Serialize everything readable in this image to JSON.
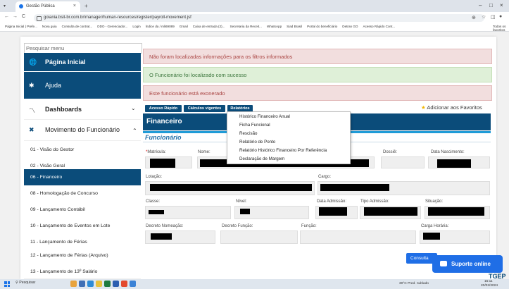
{
  "browser": {
    "tab_title": "Gestão Pública",
    "tab_close": "×",
    "new_tab": "+",
    "nav_back": "←",
    "nav_forward": "→",
    "nav_reload": "C",
    "url": "goiania.bsit-br.com.br/manager/human-resources/register/payroll-movement.jsf",
    "bookmarks": [
      "Página Inicial | Prefe...",
      "Nova guia",
      "Consulta de contrat...",
      "DDO - Gerenciador...",
      "Login",
      "Índice da / mli69089",
      "Gmail",
      "Caixa de entrada (2)...",
      "Secretaria da Receit...",
      "WhatsApp",
      "Siad Brasil",
      "Portal do beneficiário",
      "Detran GO",
      "Acesso Rápido Cont..."
    ],
    "all_favorites": "Todos os favoritos",
    "win_min": "–",
    "win_max": "□",
    "win_close": "×"
  },
  "sidebar": {
    "search_placeholder": "Pesquisar menu",
    "main_items": [
      {
        "label": "Página Inicial",
        "icon": "🌐"
      },
      {
        "label": "Ajuda",
        "icon": "✱"
      },
      {
        "label": "Dashboards",
        "icon": "〽",
        "chevron": "⌄"
      },
      {
        "label": "Movimento do Funcionário",
        "icon": "✖",
        "chevron": "⌃"
      }
    ],
    "sub_items": [
      "01 - Visão do Gestor",
      "02 - Visão Geral",
      "06 - Financeiro",
      "08 - Homologação de Concurso",
      "09 - Lançamento Contábil",
      "10 - Lançamento de Eventos em Lote",
      "11 - Lançamento de Férias",
      "12 - Lançamento de Férias (Arquivo)",
      "13 - Lançamento de 13º Salário"
    ]
  },
  "alerts": {
    "not_found": "Não foram localizadas informações para os filtros informados",
    "found": "O Funcionário foi localizado com sucesso",
    "exonerated": "Este funcionário está exonerado"
  },
  "toolbar": {
    "acesso_rapido": "Acesso Rápido",
    "calculos": "Cálculos vigentes",
    "relatorios": "Relatórios",
    "add_favorites": "Adicionar aos Favoritos",
    "star": "★"
  },
  "dropdown": [
    "Histórico Financeiro Anual",
    "Ficha Funcional",
    "Rescisão",
    "Relatório de Ponto",
    "Relatório Histórico Financeiro Por Referência",
    "Declaração de Margem"
  ],
  "form": {
    "section": "Financeiro",
    "subsection": "Funcionário",
    "required_mark": "*",
    "labels": {
      "matricula": "Matrícula:",
      "nome": "Nome:",
      "dossie": "Dossiê:",
      "nascimento": "Data Nascimento:",
      "lotacao": "Lotação:",
      "cargo": "Cargo:",
      "classe": "Classe:",
      "nivel": "Nível:",
      "admissao": "Data Admissão:",
      "tipo_admissao": "Tipo Admissão:",
      "situacao": "Situação:",
      "decreto_nomeacao": "Decreto Nomeação:",
      "decreto_funcao": "Decreto Função:",
      "funcao": "Função:",
      "carga_horaria": "Carga Horária:"
    }
  },
  "actions": {
    "consultar": "Consulta",
    "suporte": "Suporte online",
    "brand": "TGEP"
  },
  "taskbar": {
    "search": "Pesquisar",
    "weather": "30°C Pred. nublado",
    "time": "15:11",
    "date": "20/02/2024"
  },
  "colors": {
    "primary": "#0b4c7a",
    "accent": "#1f9bd7",
    "support": "#1f6ee6"
  }
}
